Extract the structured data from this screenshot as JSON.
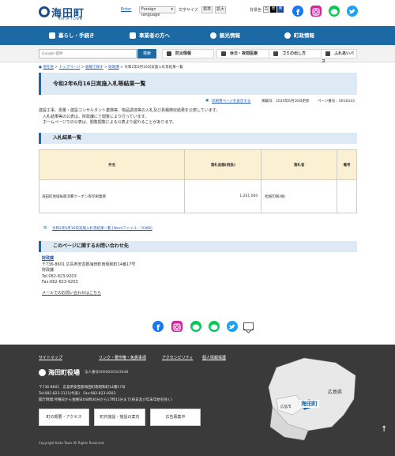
{
  "header": {
    "logo_name": "海田町",
    "logo_sub": "KAITA TOWN",
    "english_link": "Enter",
    "language_select": "Foreign language",
    "font_size_label": "文字サイズ",
    "font_normal": "標準",
    "font_large": "拡大",
    "bg_color_label": "背景色",
    "bg_color_options": [
      "白",
      "黒",
      "青"
    ]
  },
  "nav": {
    "items": [
      "暮らし・手続き",
      "事業者の方へ",
      "観光情報",
      "町政情報"
    ]
  },
  "search": {
    "placeholder": "Google 提供",
    "button": "検索"
  },
  "quick_links": [
    "防災情報",
    "休日・夜間医療",
    "ゴミの出し方",
    "ふれあいバス"
  ],
  "breadcrumb": {
    "current_label": "現在地",
    "items": [
      "トップページ",
      "組織で探す",
      "財政課"
    ],
    "current": "令和2年6月16日実施入札等結果一覧"
  },
  "page": {
    "title": "令和2年6月16日実施入札等結果一覧",
    "print_link": "印刷用ページを表示する",
    "updated": "掲載日：2020年6月16日更新",
    "page_id": "ページ番号：0016243",
    "intro": [
      "建設工事、測量・建設コンサルタント業務等、物品調達等の入札及び見積徴収結果を公表しています。",
      "入札結果等の公表は、財政課にて閲覧により行っています。",
      "ホームページでの公表は、閲覧閲覧による公表より遅れることがあります。"
    ]
  },
  "results": {
    "heading": "入札結果一覧",
    "columns": [
      "件名",
      "落札金額(税抜)",
      "落札者",
      "備考"
    ],
    "rows": [
      {
        "name": "海田町地域振興消費クーポン券印刷業務",
        "amount": "1,261,000",
        "winner": "松植印刷(株)",
        "note": ""
      }
    ],
    "attachment": "令和2年6月16日実施入札等結果一覧 [Wordファイル／ 93KB]"
  },
  "contact": {
    "heading": "このページに関するお問い合わせ先",
    "dept": "財政課",
    "address": "〒736-8601 広島県安芸郡海田町南昭和町14番17号",
    "section": "財政課",
    "tel": "Tel:082-823-9203",
    "fax": "Fax:082-823-9203",
    "mail_link": "メールでのお問い合わせはこちら"
  },
  "share_icons": [
    "facebook-icon",
    "instagram-icon",
    "line-icon",
    "line-icon",
    "twitter-icon",
    "mail-icon"
  ],
  "footer": {
    "links": [
      "サイトマップ",
      "リンク・著作権・免責事項",
      "アクセシビリティ",
      "個人情報保護"
    ],
    "logo_name": "海田町役場",
    "corp_no": "法人番号0000020343048",
    "address": "〒736-8601　広島県安芸郡海田町南昭和町14番17号",
    "tel": "Tel:082-823-2121(代表)　Fax:082-823-9203",
    "hours": "開庁時間:月曜日から金曜日の8時30分から17時15分まで(祝日及び年末年始を除く)",
    "buttons": [
      "町の概要・アクセス",
      "町内施設・施設の案内",
      "広告募集中"
    ],
    "copyright": "Copyright Kaita Town All Rights Reserved.",
    "map_label_pref": "広島県",
    "map_label_city": "広島市",
    "map_label_town": "海田町"
  },
  "colors": {
    "nav_blue": "#1b6aa5",
    "title_bg": "#dde9f4",
    "table_head": "#fbf1d2",
    "footer_bg": "#3a3a3a",
    "link": "#1f56b5"
  }
}
